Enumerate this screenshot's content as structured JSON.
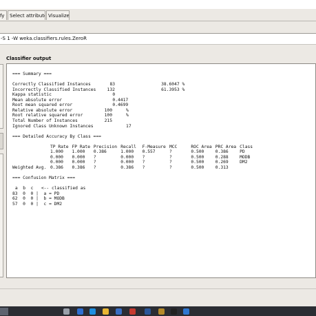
{
  "tabs": {
    "classify": "ify",
    "select_attributes": "Select attributes",
    "visualize": "Visualize"
  },
  "classifier": {
    "command": "-S 1 -W weka.classifiers.rules.ZeroR"
  },
  "output": {
    "label": "Classifier output",
    "lines": [
      {
        "tokens": [
          {
            "t": "=== Summary ===",
            "col": 0
          }
        ]
      },
      {
        "tokens": []
      },
      {
        "tokens": [
          {
            "t": "Correctly Classified Instances",
            "col": 0
          },
          {
            "t": "83",
            "col": 36
          },
          {
            "t": "38.6047 %",
            "col": 55
          }
        ]
      },
      {
        "tokens": [
          {
            "t": "Incorrectly Classified Instances",
            "col": 0
          },
          {
            "t": "132",
            "col": 35
          },
          {
            "t": "61.3953 %",
            "col": 55
          }
        ]
      },
      {
        "tokens": [
          {
            "t": "Kappa statistic",
            "col": 0
          },
          {
            "t": "0",
            "col": 37
          }
        ]
      },
      {
        "tokens": [
          {
            "t": "Mean absolute error",
            "col": 0
          },
          {
            "t": "0.4417",
            "col": 37
          }
        ]
      },
      {
        "tokens": [
          {
            "t": "Root mean squared error",
            "col": 0
          },
          {
            "t": "0.4699",
            "col": 37
          }
        ]
      },
      {
        "tokens": [
          {
            "t": "Relative absolute error",
            "col": 0
          },
          {
            "t": "100",
            "col": 34
          },
          {
            "t": "%",
            "col": 42
          }
        ]
      },
      {
        "tokens": [
          {
            "t": "Root relative squared error",
            "col": 0
          },
          {
            "t": "100",
            "col": 34
          },
          {
            "t": "%",
            "col": 42
          }
        ]
      },
      {
        "tokens": [
          {
            "t": "Total Number of Instances",
            "col": 0
          },
          {
            "t": "215",
            "col": 34
          }
        ]
      },
      {
        "tokens": [
          {
            "t": "Ignored Class Unknown Instances",
            "col": 0
          },
          {
            "t": "17",
            "col": 42
          }
        ]
      },
      {
        "tokens": []
      },
      {
        "tokens": [
          {
            "t": "=== Detailed Accuracy By Class ===",
            "col": 0
          }
        ]
      },
      {
        "tokens": []
      },
      {
        "tokens": [
          {
            "t": "TP Rate",
            "col": 14
          },
          {
            "t": "FP Rate",
            "col": 22
          },
          {
            "t": "Precision",
            "col": 30
          },
          {
            "t": "Recall",
            "col": 40
          },
          {
            "t": "F-Measure",
            "col": 48
          },
          {
            "t": "MCC",
            "col": 58
          },
          {
            "t": "ROC Area",
            "col": 66
          },
          {
            "t": "PRC Area",
            "col": 75
          },
          {
            "t": "Class",
            "col": 84
          }
        ]
      },
      {
        "tokens": [
          {
            "t": "1.000",
            "col": 14
          },
          {
            "t": "1.000",
            "col": 22
          },
          {
            "t": "0.386",
            "col": 30
          },
          {
            "t": "1.000",
            "col": 40
          },
          {
            "t": "0.557",
            "col": 48
          },
          {
            "t": "?",
            "col": 58
          },
          {
            "t": "0.500",
            "col": 66
          },
          {
            "t": "0.386",
            "col": 75
          },
          {
            "t": "PD",
            "col": 84
          }
        ]
      },
      {
        "tokens": [
          {
            "t": "0.000",
            "col": 14
          },
          {
            "t": "0.000",
            "col": 22
          },
          {
            "t": "?",
            "col": 30
          },
          {
            "t": "0.000",
            "col": 40
          },
          {
            "t": "?",
            "col": 48
          },
          {
            "t": "?",
            "col": 58
          },
          {
            "t": "0.500",
            "col": 66
          },
          {
            "t": "0.288",
            "col": 75
          },
          {
            "t": "MODB",
            "col": 84
          }
        ]
      },
      {
        "tokens": [
          {
            "t": "0.000",
            "col": 14
          },
          {
            "t": "0.000",
            "col": 22
          },
          {
            "t": "?",
            "col": 30
          },
          {
            "t": "0.000",
            "col": 40
          },
          {
            "t": "?",
            "col": 48
          },
          {
            "t": "?",
            "col": 58
          },
          {
            "t": "0.500",
            "col": 66
          },
          {
            "t": "0.269",
            "col": 75
          },
          {
            "t": "DM2",
            "col": 84
          }
        ]
      },
      {
        "tokens": [
          {
            "t": "Weighted Avg.",
            "col": 0
          },
          {
            "t": "0.386",
            "col": 14
          },
          {
            "t": "0.386",
            "col": 22
          },
          {
            "t": "?",
            "col": 30
          },
          {
            "t": "0.386",
            "col": 40
          },
          {
            "t": "?",
            "col": 48
          },
          {
            "t": "?",
            "col": 58
          },
          {
            "t": "0.500",
            "col": 66
          },
          {
            "t": "0.313",
            "col": 75
          }
        ]
      },
      {
        "tokens": []
      },
      {
        "tokens": [
          {
            "t": "=== Confusion Matrix ===",
            "col": 0
          }
        ]
      },
      {
        "tokens": []
      },
      {
        "tokens": [
          {
            "t": "a  b  c   <-- classified as",
            "col": 1
          }
        ]
      },
      {
        "tokens": [
          {
            "t": "83  0  0 |  a = PD",
            "col": 0
          }
        ]
      },
      {
        "tokens": [
          {
            "t": "62  0  0 |  b = MODB",
            "col": 0
          }
        ]
      },
      {
        "tokens": [
          {
            "t": "57  0  0 |  c = DM2",
            "col": 0
          }
        ]
      }
    ]
  },
  "taskbar": {
    "icons": [
      {
        "name": "start-icon",
        "color": "#5e6470"
      },
      {
        "name": "search-icon",
        "color": "#9aa0aa"
      },
      {
        "name": "chrome-icon",
        "color": "#2f6fd1"
      },
      {
        "name": "ie-icon",
        "color": "#1d8fe0"
      },
      {
        "name": "folder-icon",
        "color": "#e8b634"
      },
      {
        "name": "store-icon",
        "color": "#3a6fc4"
      },
      {
        "name": "mail-icon",
        "color": "#c53a2f"
      },
      {
        "name": "word-icon",
        "color": "#2b579a"
      },
      {
        "name": "weka-icon",
        "color": "#b58a2a"
      },
      {
        "name": "terminal-icon",
        "color": "#222222"
      },
      {
        "name": "app-icon",
        "color": "#2f77d1"
      }
    ]
  }
}
